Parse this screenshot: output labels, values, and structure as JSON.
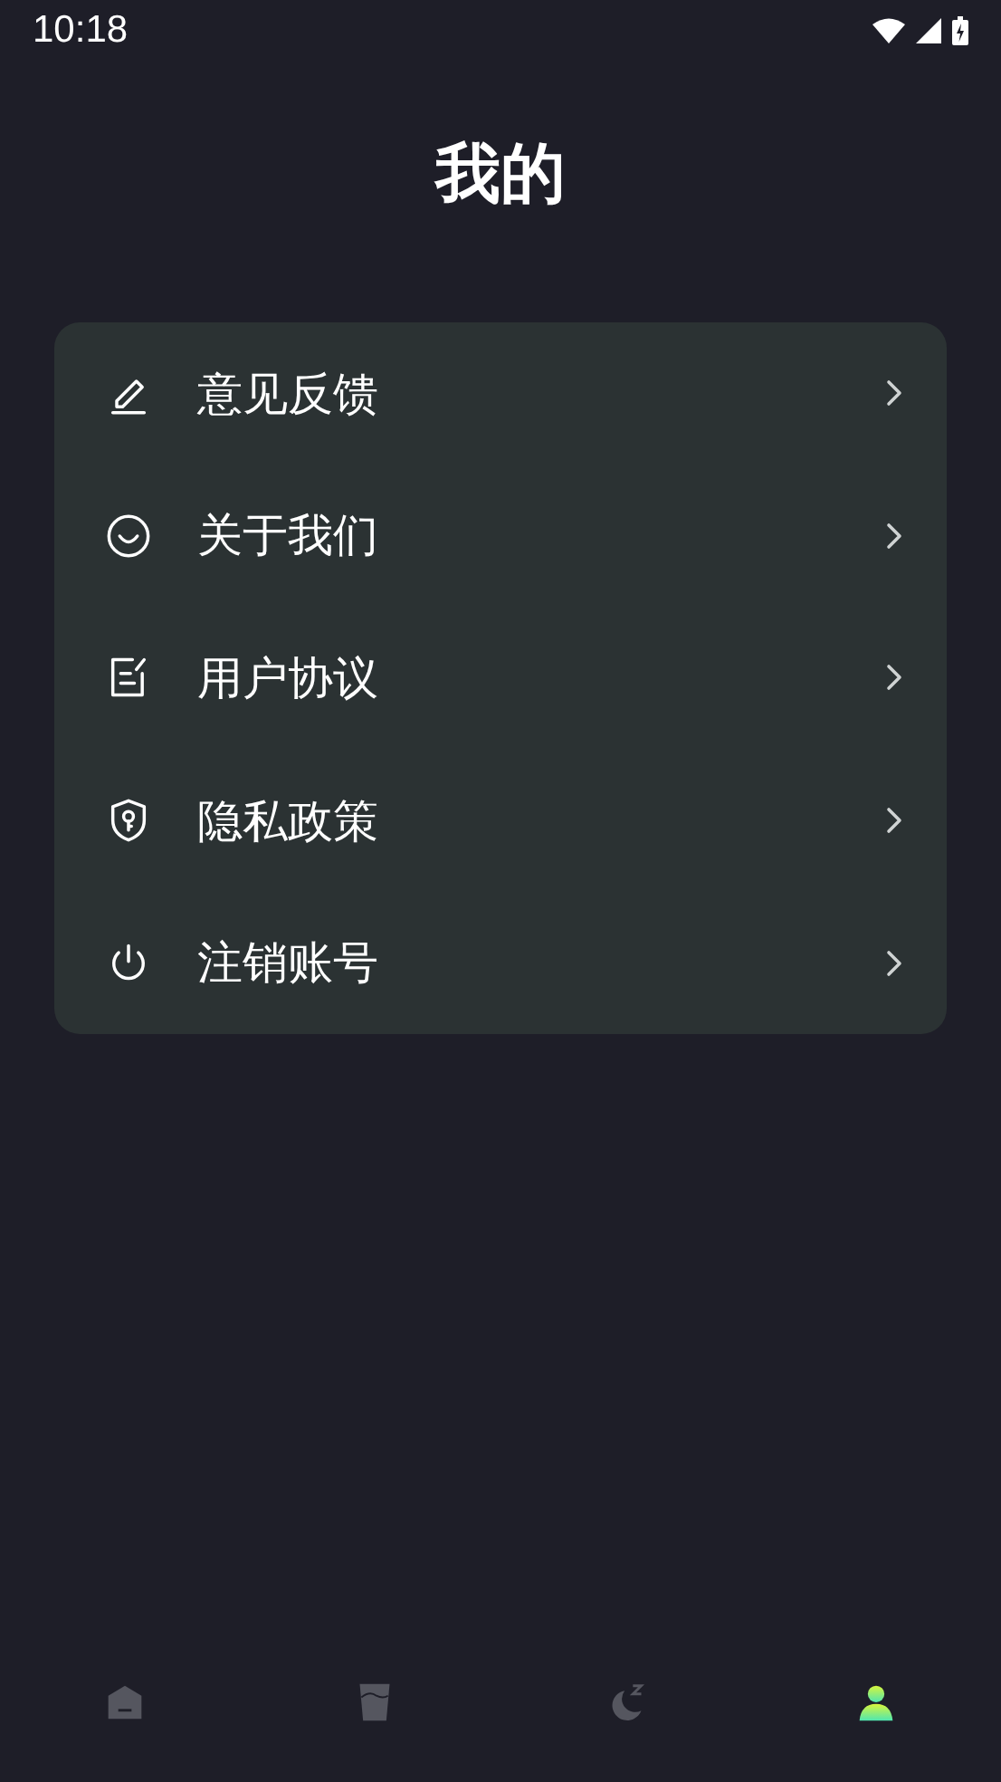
{
  "status_bar": {
    "time": "10:18"
  },
  "title": "我的",
  "menu": [
    {
      "label": "意见反馈"
    },
    {
      "label": "关于我们"
    },
    {
      "label": "用户协议"
    },
    {
      "label": "隐私政策"
    },
    {
      "label": "注销账号"
    }
  ],
  "tab_bar": [
    {
      "selected": false
    },
    {
      "selected": false
    },
    {
      "selected": false
    },
    {
      "selected": true
    }
  ]
}
